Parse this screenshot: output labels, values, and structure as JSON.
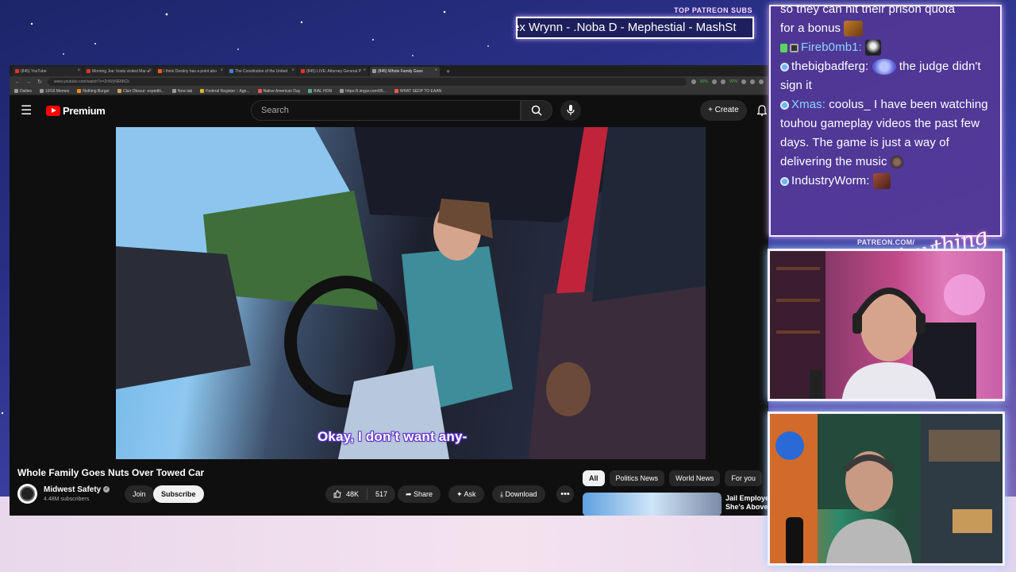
{
  "patreon": {
    "title": "TOP PATREON SUBS",
    "ticker": "ex Wrynn - .Noba D - Mephestial - MashSt"
  },
  "browser": {
    "tabs": [
      {
        "label": "(845) YouTube",
        "active": false
      },
      {
        "label": "Morning Joe: hosts visited Mar-a-",
        "active": false
      },
      {
        "label": "I think Destiny has a point abo",
        "active": false
      },
      {
        "label": "The Constitution of the United",
        "active": false
      },
      {
        "label": "(845) LIVE: Attorney General P",
        "active": false
      },
      {
        "label": "(845) Whole Family Goes",
        "active": true
      }
    ],
    "new_tab": "+",
    "url": "www.youtube.com/watch?v=ZnWyNEMtCk",
    "zoom": "90%",
    "vpn": "VPN",
    "bookmarks": [
      "Dailies",
      "10/16 Memes",
      "Nothing Burger",
      "Clair Obscur: expediti...",
      "New tab",
      "Federal Register :: Age...",
      "Native American Day",
      "BlAL HON",
      "https://i.imgur.com/95...",
      "WHAT SEDP TO EAAN"
    ]
  },
  "youtube": {
    "brand": "Premium",
    "search_placeholder": "Search",
    "create_label": "Create",
    "caption": "Okay, I don’t want any-",
    "video_title": "Whole Family Goes Nuts Over Towed Car",
    "channel_name": "Midwest Safety",
    "channel_subs": "4.48M subscribers",
    "join_label": "Join",
    "subscribe_label": "Subscribe",
    "likes": "48K",
    "comments": "517",
    "share_label": "Share",
    "ask_label": "Ask",
    "download_label": "Download",
    "more_label": "•••",
    "chips": [
      {
        "label": "All",
        "active": true
      },
      {
        "label": "Politics News",
        "active": false
      },
      {
        "label": "World News",
        "active": false
      },
      {
        "label": "For you",
        "active": false
      }
    ],
    "rec_title": "Jail Employe She's Above"
  },
  "chat": {
    "messages": [
      {
        "user": "",
        "text": "so they can hit their prison quota"
      },
      {
        "user": "",
        "text": "for a bonus"
      },
      {
        "user": "Fireb0mb1:",
        "text": ""
      },
      {
        "user": "thebigbadferg:",
        "text": "the judge didn't sign it"
      },
      {
        "user": "Xmas:",
        "text": "coolus_ I have been watching touhou gameplay videos the past few days. The game is just a way of delivering the music"
      },
      {
        "user": "IndustryWorm:",
        "text": ""
      }
    ]
  },
  "cam": {
    "patreon_label": "PATREON.COM/",
    "script_label": "Anything else"
  },
  "colors": {
    "yt_red": "#ff0000",
    "chat_bg": "#5638a0",
    "caption_outline": "#5a2fc6",
    "username_blue": "#8fd3ff"
  },
  "icons": [
    "search-icon",
    "mic-icon",
    "bell-icon",
    "hamburger-icon",
    "like-icon",
    "share-icon",
    "ask-icon",
    "download-icon",
    "verified-icon"
  ]
}
